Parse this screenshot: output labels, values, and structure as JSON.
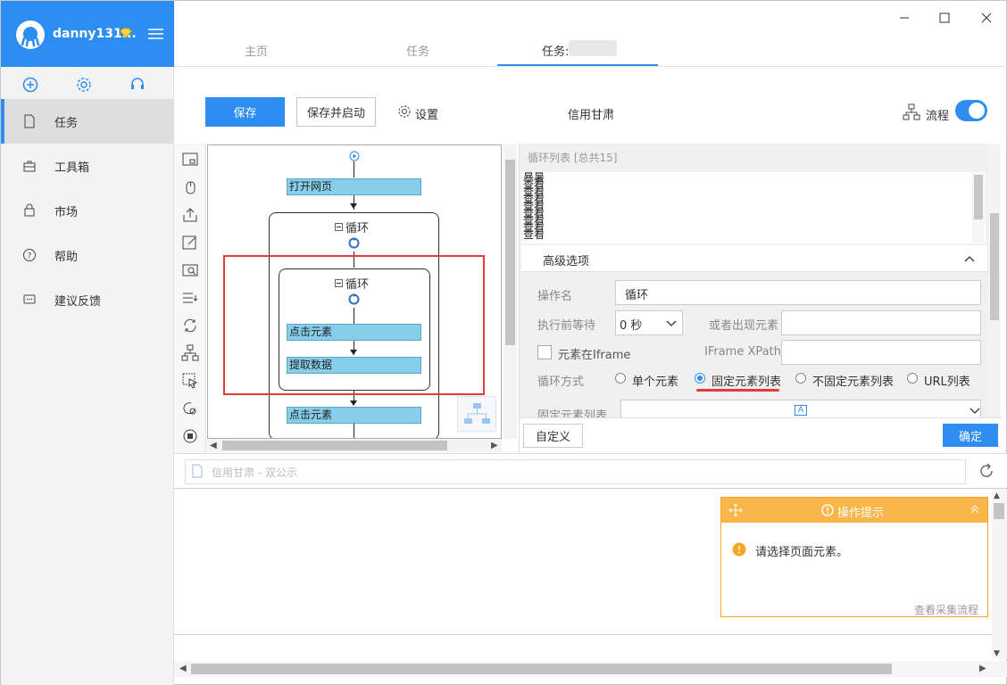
{
  "user": {
    "name": "danny131..."
  },
  "sidebar": {
    "items": [
      {
        "label": "任务"
      },
      {
        "label": "工具箱"
      },
      {
        "label": "市场"
      },
      {
        "label": "帮助"
      },
      {
        "label": "建议反馈"
      }
    ]
  },
  "tabs": [
    {
      "label": "主页"
    },
    {
      "label": "任务"
    },
    {
      "label": "任务:"
    }
  ],
  "toolbar": {
    "save_label": "保存",
    "save_start_label": "保存并启动",
    "settings_label": "设置",
    "task_name": "信用甘肃",
    "flow_label": "流程"
  },
  "flow": {
    "open_page": "打开网页",
    "outer_loop": "循环",
    "inner_loop": "循环",
    "click_element_1": "点击元素",
    "extract_data": "提取数据",
    "click_element_2": "点击元素"
  },
  "right_panel": {
    "loop_list_title": "循环列表 [总共15]",
    "loop_list_entries": [
      "暴暑",
      "查看",
      "查看",
      "查看",
      "查看",
      "查看",
      "查看",
      "查看",
      "查看"
    ],
    "advanced_label": "高级选项",
    "op_name_label": "操作名",
    "op_name_value": "循环",
    "wait_label": "执行前等待",
    "wait_value": "0 秒",
    "or_appear_label": "或者出现元素",
    "iframe_check_label": "元素在Iframe",
    "iframe_xpath_label": "IFrame XPath",
    "loop_mode_label": "循环方式",
    "loop_modes": [
      "单个元素",
      "固定元素列表",
      "不固定元素列表",
      "URL列表"
    ],
    "fixed_list_label": "固定元素列表",
    "custom_label": "自定义",
    "confirm_label": "确定"
  },
  "address": {
    "text": "信用甘肃 - 双公示"
  },
  "tip": {
    "title": "操作提示",
    "body": "请选择页面元素。",
    "link": "查看采集流程"
  },
  "colors": {
    "accent": "#2e8df0",
    "tip_orange": "#f7b54a",
    "step_blue": "#87ceeb",
    "highlight_red": "#e23b3b"
  }
}
